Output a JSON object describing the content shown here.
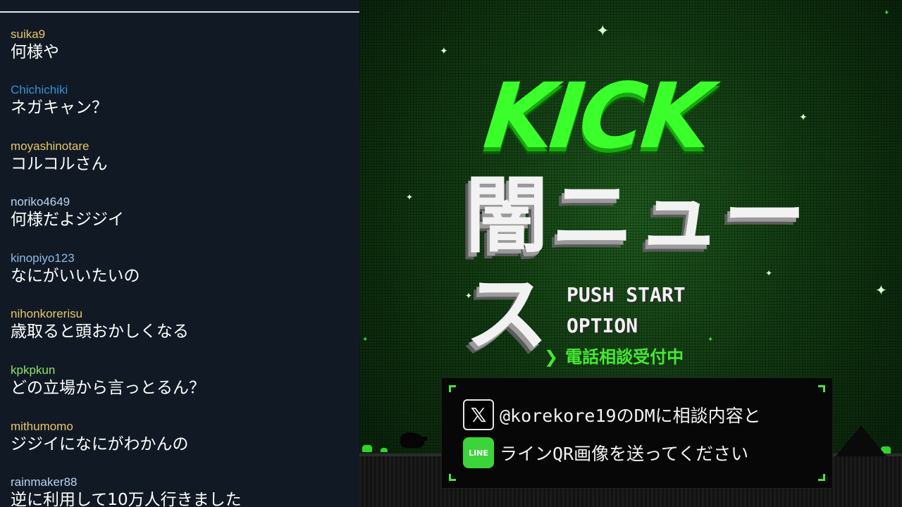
{
  "chat": {
    "messages": [
      {
        "user": "suika9",
        "text": "何様や",
        "color": "#e9c46a"
      },
      {
        "user": "Chichichiki",
        "text": "ネガキャン？",
        "color": "#3b8fd9"
      },
      {
        "user": "moyashinotare",
        "text": "コルコルさん",
        "color": "#e9c46a"
      },
      {
        "user": "noriko4649",
        "text": "何様だよジジイ",
        "color": "#b9d4f2"
      },
      {
        "user": "kinopiyo123",
        "text": "なにがいいたいの",
        "color": "#8fb8e8"
      },
      {
        "user": "nihonkorerisu",
        "text": "歳取ると頭おかしくなる",
        "color": "#e9c46a"
      },
      {
        "user": "kpkpkun",
        "text": "どの立場から言っとるん？",
        "color": "#8fe36f"
      },
      {
        "user": "mithumomo",
        "text": "ジジイになにがわかんの",
        "color": "#e9c46a"
      },
      {
        "user": "rainmaker88",
        "text": "逆に利用して10万人行きました",
        "color": "#b9d4f2"
      }
    ]
  },
  "game": {
    "logo": "KICK",
    "title": "闇ニュース",
    "menu": {
      "push_start": "PUSH START",
      "option": "OPTION",
      "cursor": "❯",
      "consult": "電話相談受付中"
    },
    "dm": {
      "x_icon": "x-logo-icon",
      "x_icon_glyph": "𝕏",
      "line1": "@korekore19のDMに相談内容と",
      "line_icon": "line-app-icon",
      "line_icon_glyph": "LINE",
      "line2": "ラインQR画像を送ってください"
    }
  }
}
